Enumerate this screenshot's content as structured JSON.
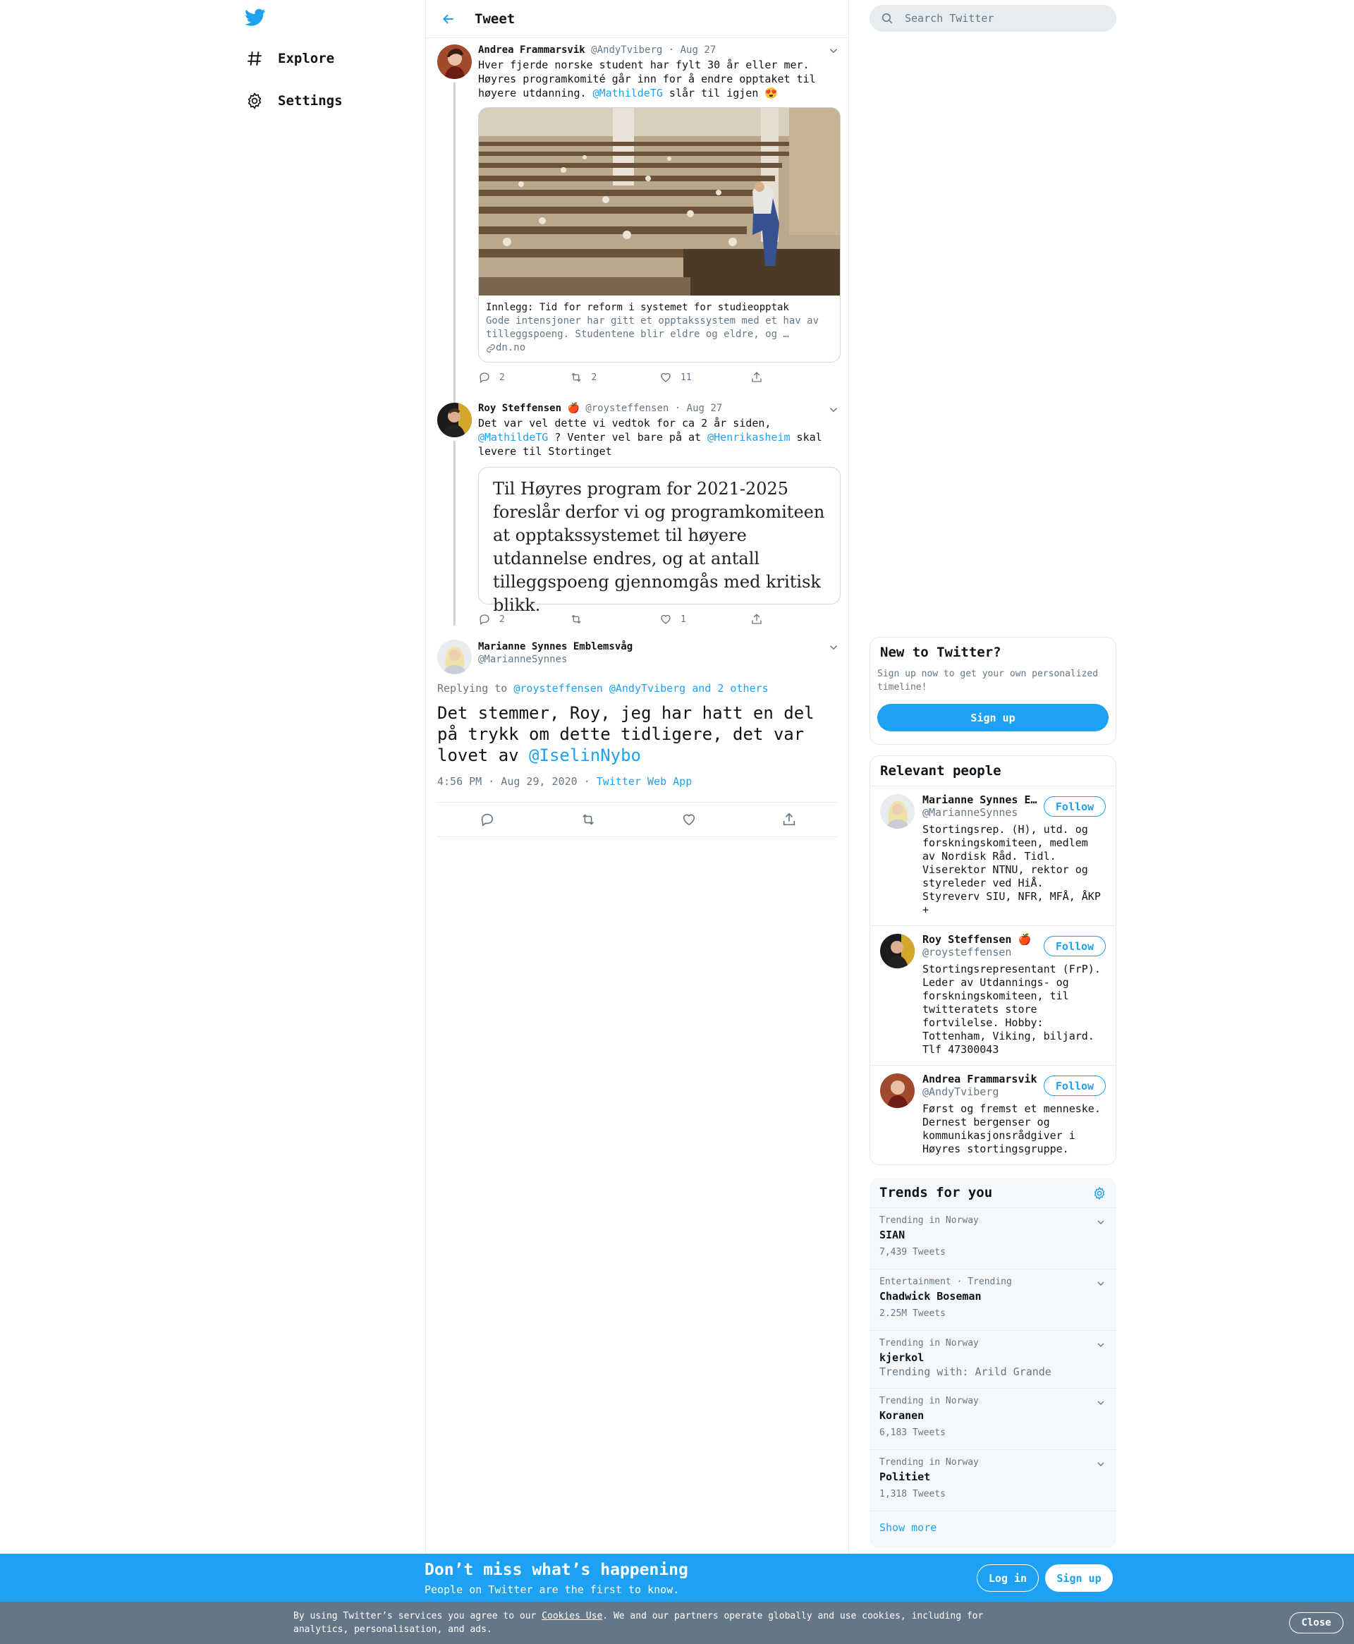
{
  "nav": {
    "logo_icon": "twitter-bird-icon",
    "items": [
      {
        "label": "Explore",
        "icon": "hashtag-icon"
      },
      {
        "label": "Settings",
        "icon": "gear-icon"
      }
    ]
  },
  "header": {
    "title": "Tweet",
    "back_icon": "arrow-left-icon"
  },
  "thread": [
    {
      "name": "Andrea Frammarsvik",
      "handle": "@AndyTviberg",
      "sep": "·",
      "date": "Aug 27",
      "text_1": "Hver fjerde norske student har fylt 30 år eller mer. Høyres programkomité går inn for å endre opptaket til høyere utdanning. ",
      "mention": "@MathildeTG",
      "text_2": " slår til igjen 😍",
      "card": {
        "title": "Innlegg: Tid for reform i systemet for studieopptak",
        "description": "Gode intensjoner har gitt et opptakssystem med et hav av tilleggspoeng. Studentene blir eldre og eldre, og …",
        "domain": "dn.no"
      },
      "replies": "2",
      "retweets": "2",
      "likes": "11"
    },
    {
      "name": "Roy Steffensen",
      "emoji": "🍎",
      "handle": "@roysteffensen",
      "sep": "·",
      "date": "Aug 27",
      "text_1": "Det var vel dette vi vedtok for ca 2 år siden, ",
      "mention_1": "@MathildeTG",
      "text_2": " ? Venter vel bare på at ",
      "mention_2": "@Henrikasheim",
      "text_3": " skal levere til Stortinget",
      "quote_image_text": "Til Høyres program for 2021-2025 foreslår derfor vi og programkomiteen at opptakssystemet til høyere utdannelse endres, og at antall tilleggspoeng gjennomgås med kritisk blikk.",
      "replies": "2",
      "retweets": "",
      "likes": "1"
    }
  ],
  "focus": {
    "name": "Marianne Synnes Emblemsvåg",
    "handle": "@MarianneSynnes",
    "replying_prefix": "Replying to ",
    "replying_to": "@roysteffensen @AndyTviberg",
    "replying_and": " and ",
    "replying_others": "2 others",
    "text": "Det stemmer, Roy, jeg har hatt en del på trykk om dette tidligere, det var lovet av ",
    "mention": "@IselinNybo",
    "time": "4:56 PM · Aug 29, 2020 · ",
    "source": "Twitter Web App"
  },
  "search": {
    "placeholder": "Search Twitter"
  },
  "new_to_twitter": {
    "title": "New to Twitter?",
    "body": "Sign up now to get your own personalized timeline!",
    "button": "Sign up"
  },
  "relevant_people": {
    "title": "Relevant people",
    "follow_label": "Follow",
    "people": [
      {
        "name": "Marianne Synnes Emblemsvåg",
        "handle": "@MarianneSynnes",
        "bio": "Stortingsrep. (H), utd. og forskningskomiteen, medlem av Nordisk Råd. Tidl. Viserektor NTNU, rektor og styreleder ved HiÅ. Styreverv SIU, NFR, MFÅ, ÅKP +"
      },
      {
        "name": "Roy Steffensen 🍎",
        "handle": "@roysteffensen",
        "bio": "Stortingsrepresentant (FrP). Leder av Utdannings- og forskningskomiteen, til twitteratets store fortvilelse. Hobby: Tottenham, Viking, biljard. Tlf 47300043"
      },
      {
        "name": "Andrea Frammarsvik",
        "handle": "@AndyTviberg",
        "bio": "Først og fremst et menneske. Dernest bergenser og kommunikasjonsrådgiver i Høyres stortingsgruppe."
      }
    ]
  },
  "trends": {
    "title": "Trends for you",
    "items": [
      {
        "meta": "Trending in Norway",
        "name": "SIAN",
        "count": "7,439 Tweets"
      },
      {
        "meta": "Entertainment · Trending",
        "name": "Chadwick Boseman",
        "count": "2.25M Tweets"
      },
      {
        "meta": "Trending in Norway",
        "name": "kjerkol",
        "count": "Trending with: Arild Grande"
      },
      {
        "meta": "Trending in Norway",
        "name": "Koranen",
        "count": "6,183 Tweets"
      },
      {
        "meta": "Trending in Norway",
        "name": "Politiet",
        "count": "1,318 Tweets"
      }
    ],
    "show_more": "Show more"
  },
  "bottom_bar": {
    "title": "Don’t miss what’s happening",
    "subtitle": "People on Twitter are the first to know.",
    "login": "Log in",
    "signup": "Sign up"
  },
  "cookie": {
    "prefix": "By using Twitter’s services you agree to our ",
    "link": "Cookies Use",
    "suffix": ". We and our partners operate globally and use cookies, including for analytics, personalisation, and ads.",
    "close": "Close"
  },
  "colors": {
    "accent": "#1da1f2",
    "secondary_text": "#657786",
    "border": "#e6ecf0"
  }
}
